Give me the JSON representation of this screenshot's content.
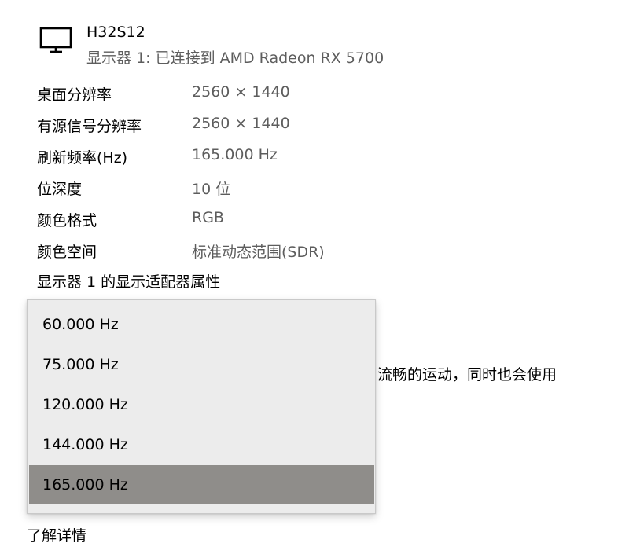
{
  "display": {
    "icon": "monitor-icon",
    "name": "H32S12",
    "subtitle": "显示器 1: 已连接到 AMD Radeon RX 5700"
  },
  "properties": [
    {
      "label": "桌面分辨率",
      "value": "2560 × 1440"
    },
    {
      "label": "有源信号分辨率",
      "value": "2560 × 1440"
    },
    {
      "label": "刷新频率(Hz)",
      "value": "165.000 Hz"
    },
    {
      "label": "位深度",
      "value": "10 位"
    },
    {
      "label": "颜色格式",
      "value": "RGB"
    },
    {
      "label": "颜色空间",
      "value": "标准动态范围(SDR)"
    }
  ],
  "adapter_link": "显示器 1 的显示适配器属性",
  "background_text": "流畅的运动，同时也会使用",
  "learn_more": "了解详情",
  "refresh_dropdown": {
    "options": [
      "60.000 Hz",
      "75.000 Hz",
      "120.000 Hz",
      "144.000 Hz",
      "165.000 Hz"
    ],
    "selected": "165.000 Hz",
    "selected_color": "#8f8d8a",
    "background_color": "#ececec"
  }
}
